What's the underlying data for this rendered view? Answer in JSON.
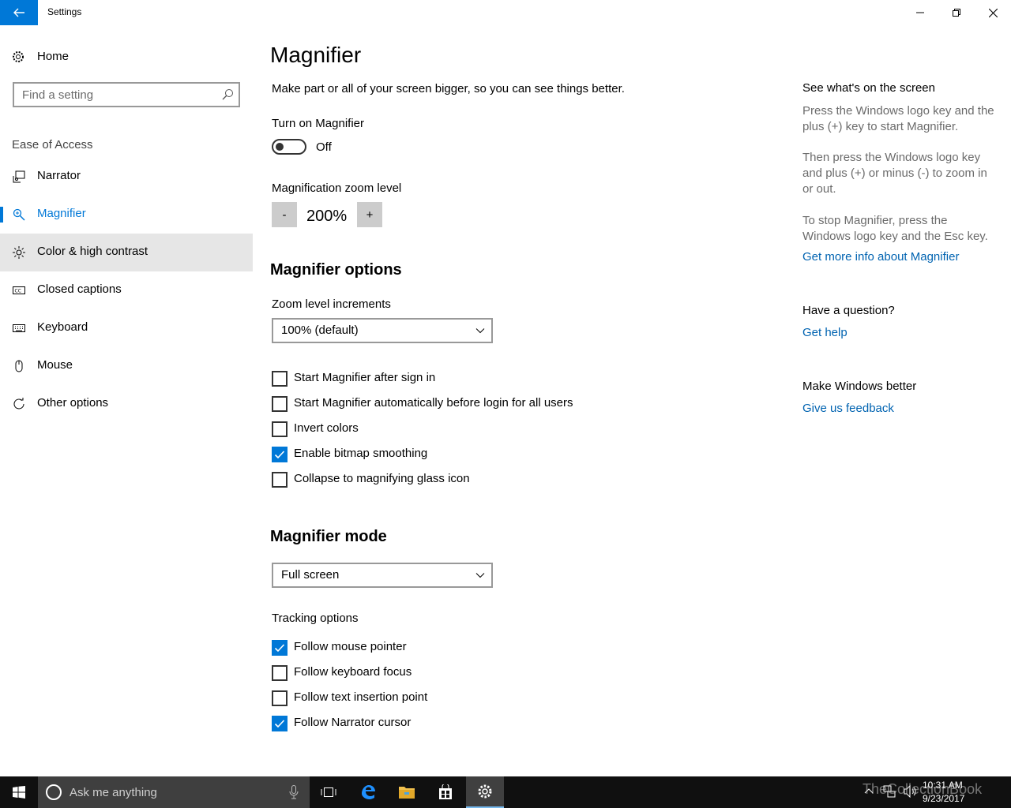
{
  "window": {
    "title": "Settings"
  },
  "nav": {
    "home_label": "Home",
    "search_placeholder": "Find a setting",
    "section": "Ease of Access",
    "items": [
      {
        "label": "Narrator",
        "icon": "narrator-icon"
      },
      {
        "label": "Magnifier",
        "icon": "magnifier-icon",
        "selected": true
      },
      {
        "label": "Color & high contrast",
        "icon": "brightness-icon"
      },
      {
        "label": "Closed captions",
        "icon": "closed-captions-icon"
      },
      {
        "label": "Keyboard",
        "icon": "keyboard-icon"
      },
      {
        "label": "Mouse",
        "icon": "mouse-icon"
      },
      {
        "label": "Other options",
        "icon": "other-options-icon"
      }
    ]
  },
  "main": {
    "title": "Magnifier",
    "description": "Make part or all of your screen bigger, so you can see things better.",
    "turn_on_label": "Turn on Magnifier",
    "toggle_state": "Off",
    "zoom_label": "Magnification zoom level",
    "zoom_minus": "-",
    "zoom_value": "200%",
    "zoom_plus": "+",
    "options_heading": "Magnifier options",
    "increments_label": "Zoom level increments",
    "increments_value": "100% (default)",
    "options": [
      {
        "label": "Start Magnifier after sign in",
        "checked": false
      },
      {
        "label": "Start Magnifier automatically before login for all users",
        "checked": false
      },
      {
        "label": "Invert colors",
        "checked": false
      },
      {
        "label": "Enable bitmap smoothing",
        "checked": true
      },
      {
        "label": "Collapse to magnifying glass icon",
        "checked": false
      }
    ],
    "mode_heading": "Magnifier mode",
    "mode_value": "Full screen",
    "tracking_label": "Tracking options",
    "tracking": [
      {
        "label": "Follow mouse pointer",
        "checked": true
      },
      {
        "label": "Follow keyboard focus",
        "checked": false
      },
      {
        "label": "Follow text insertion point",
        "checked": false
      },
      {
        "label": "Follow Narrator cursor",
        "checked": true
      }
    ]
  },
  "right": {
    "heading1": "See what's on the screen",
    "para1": "Press the Windows logo key and the plus (+) key to start Magnifier.",
    "para2": "Then press the Windows logo key and plus (+) or minus (-) to zoom in or out.",
    "para3": "To stop Magnifier, press the Windows logo key and the Esc key.",
    "link1": "Get more info about Magnifier",
    "heading2": "Have a question?",
    "link2": "Get help",
    "heading3": "Make Windows better",
    "link3": "Give us feedback"
  },
  "taskbar": {
    "search_placeholder": "Ask me anything",
    "time": "10:31 AM",
    "date": "9/23/2017",
    "watermark": "TheCollectionBook"
  },
  "colors": {
    "accent": "#0078d7",
    "link": "#0063b1",
    "taskbar": "#101010"
  }
}
